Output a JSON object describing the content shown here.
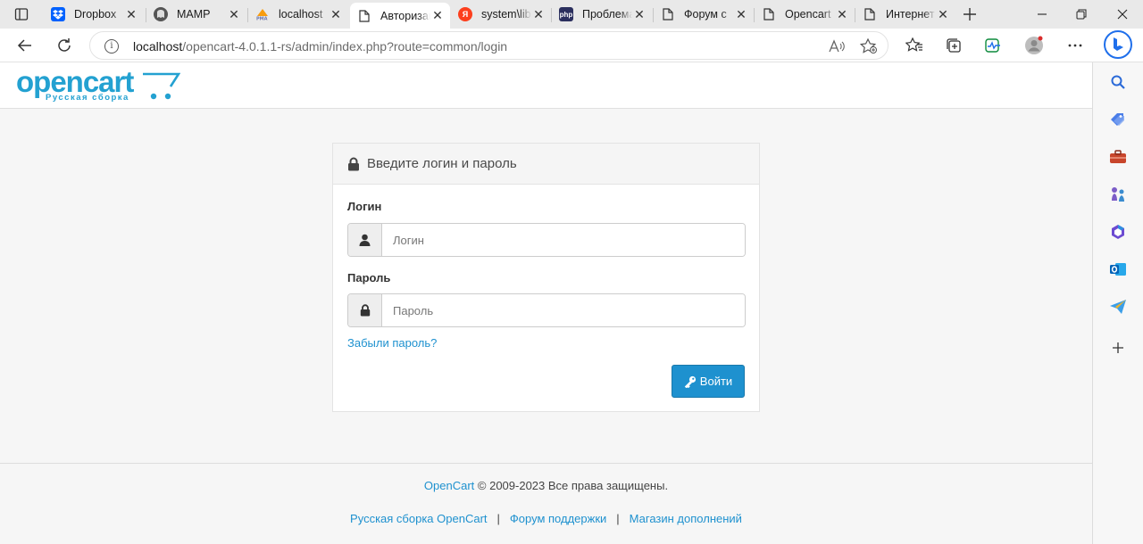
{
  "browser": {
    "tabs": [
      {
        "title": "Dropbox",
        "icon": "dropbox-icon",
        "active": false
      },
      {
        "title": "MAMP",
        "icon": "mamp-icon",
        "active": false
      },
      {
        "title": "localhost",
        "icon": "phpmyadmin-icon",
        "active": false
      },
      {
        "title": "Авторизация",
        "icon": "page-icon",
        "active": true
      },
      {
        "title": "system\\library",
        "icon": "yandex-icon",
        "active": false
      },
      {
        "title": "Проблема",
        "icon": "php-icon",
        "active": false
      },
      {
        "title": "Форум с",
        "icon": "page-icon",
        "active": false
      },
      {
        "title": "Opencart",
        "icon": "page-icon",
        "active": false
      },
      {
        "title": "Интернет",
        "icon": "page-icon",
        "active": false
      }
    ],
    "address": {
      "host": "localhost",
      "path": "/opencart-4.0.1.1-rs/admin/index.php?route=common/login"
    }
  },
  "page": {
    "logo": {
      "word": "opencart",
      "sub": "Русская сборка"
    },
    "login_card": {
      "title": "Введите логин и пароль",
      "username_label": "Логин",
      "username_placeholder": "Логин",
      "password_label": "Пароль",
      "password_placeholder": "Пароль",
      "forgot_link": "Забыли пароль?",
      "submit_label": "Войти"
    },
    "footer": {
      "brand_link": "OpenCart",
      "copyright": " © 2009-2023 Все права защищены.",
      "links": [
        "Русская сборка OpenCart",
        "Форум поддержки",
        "Магазин дополнений"
      ],
      "separator": "|"
    }
  },
  "colors": {
    "accent": "#1e91cf",
    "logo": "#23a1d1",
    "page_bg": "#f6f6f6"
  }
}
